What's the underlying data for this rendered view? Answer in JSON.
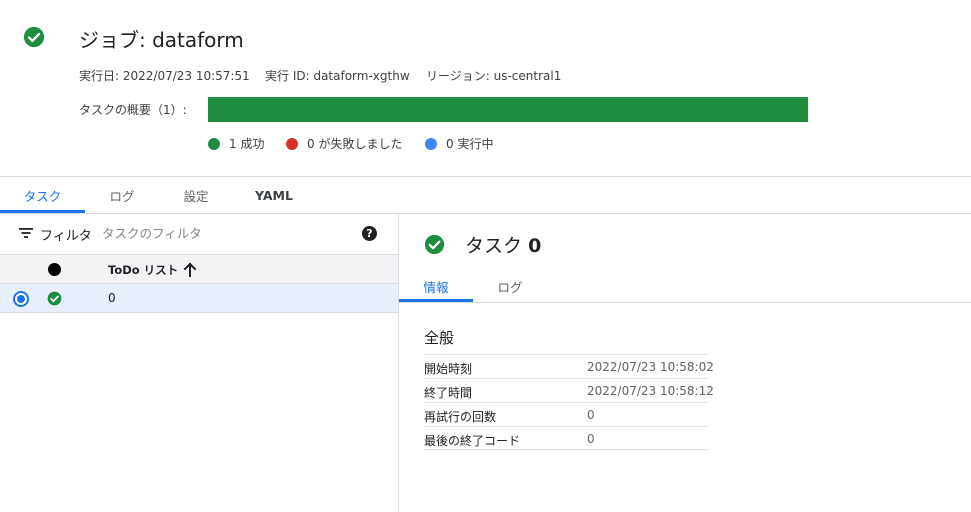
{
  "header": {
    "title": "ジョブ: dataform",
    "meta": {
      "execution_date": "実行日: 2022/07/23 10:57:51",
      "execution_id": "実行 ID: dataform-xgthw",
      "region": "リージョン: us-central1"
    },
    "task_summary_label": "タスクの概要（1）:",
    "progress_success_fraction": 1.0,
    "legend": {
      "success": "1 成功",
      "failed": "0 が失敗しました",
      "running": "0 実行中"
    }
  },
  "tabs": [
    "タスク",
    "ログ",
    "設定",
    "YAML"
  ],
  "left_pane": {
    "filter_label": "フィルタ",
    "filter_placeholder": "タスクのフィルタ",
    "help_icon": "?",
    "column_header": "ToDo リスト",
    "rows": [
      {
        "value": "0"
      }
    ]
  },
  "detail": {
    "title_prefix": "タスク",
    "title_number": "0",
    "tabs": [
      "情報",
      "ログ"
    ],
    "section_title": "全般",
    "info": [
      {
        "key": "開始時刻",
        "value": "2022/07/23 10:58:02"
      },
      {
        "key": "終了時間",
        "value": "2022/07/23 10:58:12"
      },
      {
        "key": "再試行の回数",
        "value": "0"
      },
      {
        "key": "最後の終了コード",
        "value": "0"
      }
    ]
  },
  "colors": {
    "success": "#1e8e3e",
    "failed": "#d93025",
    "running": "#4285f4",
    "accent": "#1a73e8"
  },
  "icons": {
    "header_status": "check-circle-icon",
    "filter": "filter-icon",
    "help": "help-icon",
    "sort": "arrow-up-icon"
  }
}
